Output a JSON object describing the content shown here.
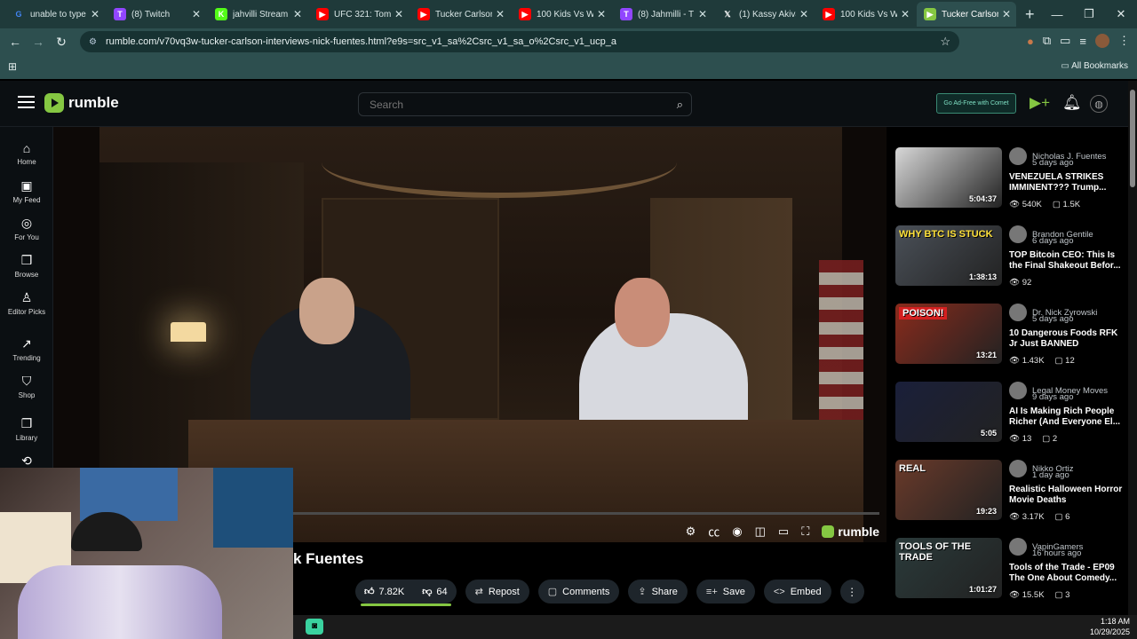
{
  "browser": {
    "tabs": [
      {
        "title": "unable to type",
        "icon": "google-icon",
        "color": "#ffffff"
      },
      {
        "title": "(8) Twitch",
        "icon": "twitch-icon",
        "color": "#9146ff"
      },
      {
        "title": "jahvilli Stream",
        "icon": "kick-icon",
        "color": "#53fc18"
      },
      {
        "title": "UFC 321: Tom",
        "icon": "youtube-icon",
        "color": "#ff0000"
      },
      {
        "title": "Tucker Carlson",
        "icon": "youtube-icon",
        "color": "#ff0000"
      },
      {
        "title": "100 Kids Vs W",
        "icon": "youtube-icon",
        "color": "#ff0000"
      },
      {
        "title": "(8) Jahmilli - T",
        "icon": "twitch-icon",
        "color": "#9146ff"
      },
      {
        "title": "(1) Kassy Akiva",
        "icon": "x-icon",
        "color": "#ffffff"
      },
      {
        "title": "100 Kids Vs W",
        "icon": "youtube-icon",
        "color": "#ff0000"
      },
      {
        "title": "Tucker Carlson",
        "icon": "rumble-icon",
        "color": "#85c742"
      }
    ],
    "url": "rumble.com/v70vq3w-tucker-carlson-interviews-nick-fuentes.html?e9s=src_v1_sa%2Csrc_v1_sa_o%2Csrc_v1_ucp_a",
    "all_bookmarks": "All Bookmarks"
  },
  "header": {
    "logo_text": "rumble",
    "search_placeholder": "Search",
    "adfree_text": "Go Ad-Free with Comet"
  },
  "rail": [
    {
      "label": "Home",
      "icon": "home-icon"
    },
    {
      "label": "My Feed",
      "icon": "feed-icon"
    },
    {
      "label": "For You",
      "icon": "for-you-icon"
    },
    {
      "label": "Browse",
      "icon": "browse-icon"
    },
    {
      "label": "Editor Picks",
      "icon": "editor-picks-icon"
    },
    {
      "label": "Trending",
      "icon": "trending-icon"
    },
    {
      "label": "Shop",
      "icon": "shop-icon"
    },
    {
      "label": "Library",
      "icon": "library-icon"
    }
  ],
  "video": {
    "title_visible": "k Fuentes",
    "brand": "rumble"
  },
  "actions": {
    "likes": "7.82K",
    "dislikes": "64",
    "repost": "Repost",
    "comments": "Comments",
    "share": "Share",
    "save": "Save",
    "embed": "Embed"
  },
  "related": [
    {
      "channel": "Nicholas J. Fuentes",
      "ago": "5 days ago",
      "title": "VENEZUELA STRIKES IMMINENT??? Trump...",
      "views": "540K",
      "comments": "1.5K",
      "duration": "5:04:37",
      "thumb_text": "",
      "thumb_color": "#d8d8d8"
    },
    {
      "channel": "Brandon Gentile",
      "ago": "6 days ago",
      "title": "TOP Bitcoin CEO: This Is the Final Shakeout Befor...",
      "views": "92",
      "comments": "",
      "duration": "1:38:13",
      "thumb_text": "WHY BTC IS STUCK",
      "thumb_color": "#4a5058"
    },
    {
      "channel": "Dr. Nick Zyrowski",
      "ago": "5 days ago",
      "title": "10 Dangerous Foods RFK Jr Just BANNED",
      "views": "1.43K",
      "comments": "12",
      "duration": "13:21",
      "thumb_text": "POISON!",
      "thumb_color": "#8a2b1c"
    },
    {
      "channel": "Legal Money Moves",
      "ago": "9 days ago",
      "title": "AI Is Making Rich People Richer (And Everyone El...",
      "views": "13",
      "comments": "2",
      "duration": "5:05",
      "thumb_text": "",
      "thumb_color": "#1a1f3a"
    },
    {
      "channel": "Nikko Ortiz",
      "ago": "1 day ago",
      "title": "Realistic Halloween Horror Movie Deaths",
      "views": "3.17K",
      "comments": "6",
      "duration": "19:23",
      "thumb_text": "REAL",
      "thumb_color": "#6a3a2a"
    },
    {
      "channel": "VapinGamers",
      "ago": "16 hours ago",
      "title": "Tools of the Trade - EP09 The One About Comedy...",
      "views": "15.5K",
      "comments": "3",
      "duration": "1:01:27",
      "thumb_text": "TOOLS OF THE TRADE",
      "thumb_color": "#2a3a3a"
    }
  ],
  "taskbar": {
    "time": "1:18 AM",
    "date": "10/29/2025"
  }
}
